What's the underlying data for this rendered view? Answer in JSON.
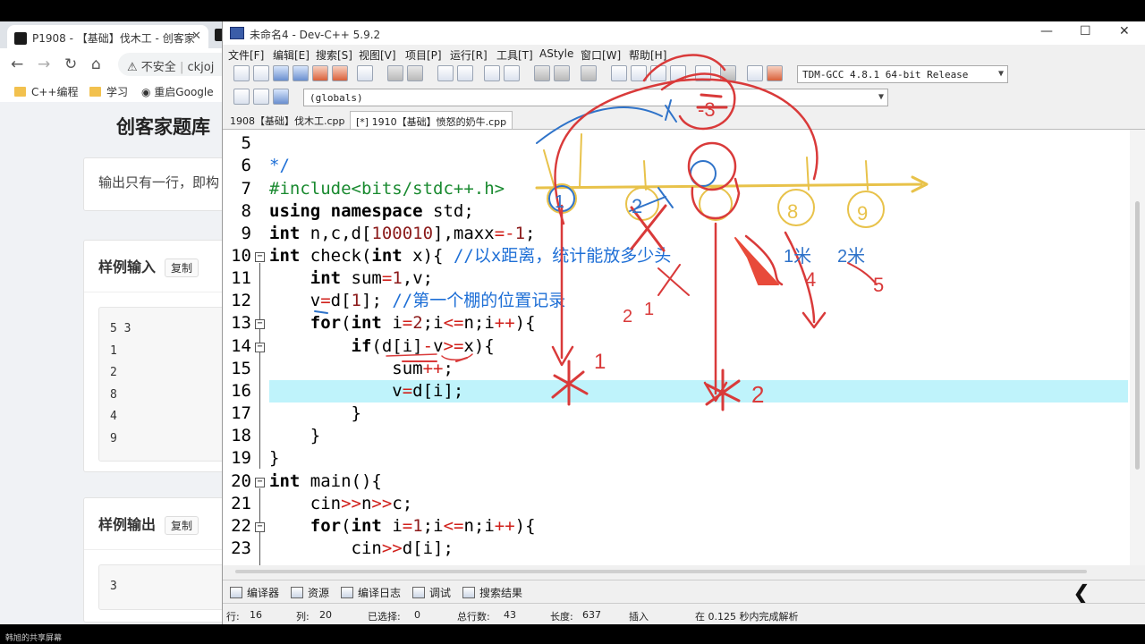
{
  "browser": {
    "tab_title": "P1908 - 【基础】伐木工 - 创客家",
    "tab_close": "✕",
    "address_warning": "不安全",
    "address_text": "ckjoj",
    "bookmarks": [
      "C++编程",
      "学习",
      "重启Google"
    ],
    "site_title": "创客家题库",
    "output_desc": "输出只有一行，即构",
    "sample_input_title": "样例输入",
    "sample_output_title": "样例输出",
    "copy_label": "复制",
    "sample_input_lines": [
      "5 3",
      "1",
      "2",
      "8",
      "4",
      "9"
    ],
    "sample_output_lines": [
      "3"
    ]
  },
  "devcpp": {
    "window_title": "未命名4 - Dev-C++ 5.9.2",
    "menu": [
      "文件[F]",
      "编辑[E]",
      "搜索[S]",
      "视图[V]",
      "项目[P]",
      "运行[R]",
      "工具[T]",
      "AStyle",
      "窗口[W]",
      "帮助[H]"
    ],
    "compiler": "TDM-GCC 4.8.1 64-bit Release",
    "scope": "(globals)",
    "file_tabs": [
      "1908【基础】伐木工.cpp",
      "[*] 1910【基础】愤怒的奶牛.cpp"
    ],
    "line_numbers": [
      "5",
      "6",
      "7",
      "8",
      "9",
      "10",
      "11",
      "12",
      "13",
      "14",
      "15",
      "16",
      "17",
      "18",
      "19",
      "20",
      "21",
      "22",
      "23"
    ],
    "bottom_tabs": [
      "编译器",
      "资源",
      "编译日志",
      "调试",
      "搜索结果"
    ],
    "status": {
      "row_label": "行:",
      "row": "16",
      "col_label": "列:",
      "col": "20",
      "sel_label": "已选择:",
      "sel": "0",
      "total_label": "总行数:",
      "total": "43",
      "len_label": "长度:",
      "len": "637",
      "mode": "插入",
      "parse": "在 0.125 秒内完成解析"
    }
  },
  "annotations": {
    "labels": [
      "1米",
      "2米",
      "1",
      "2",
      "8",
      "9",
      "-3",
      "2",
      "1",
      "2",
      "1",
      "5",
      "4"
    ]
  },
  "screen_share_text": "韩旭的共享屏幕"
}
